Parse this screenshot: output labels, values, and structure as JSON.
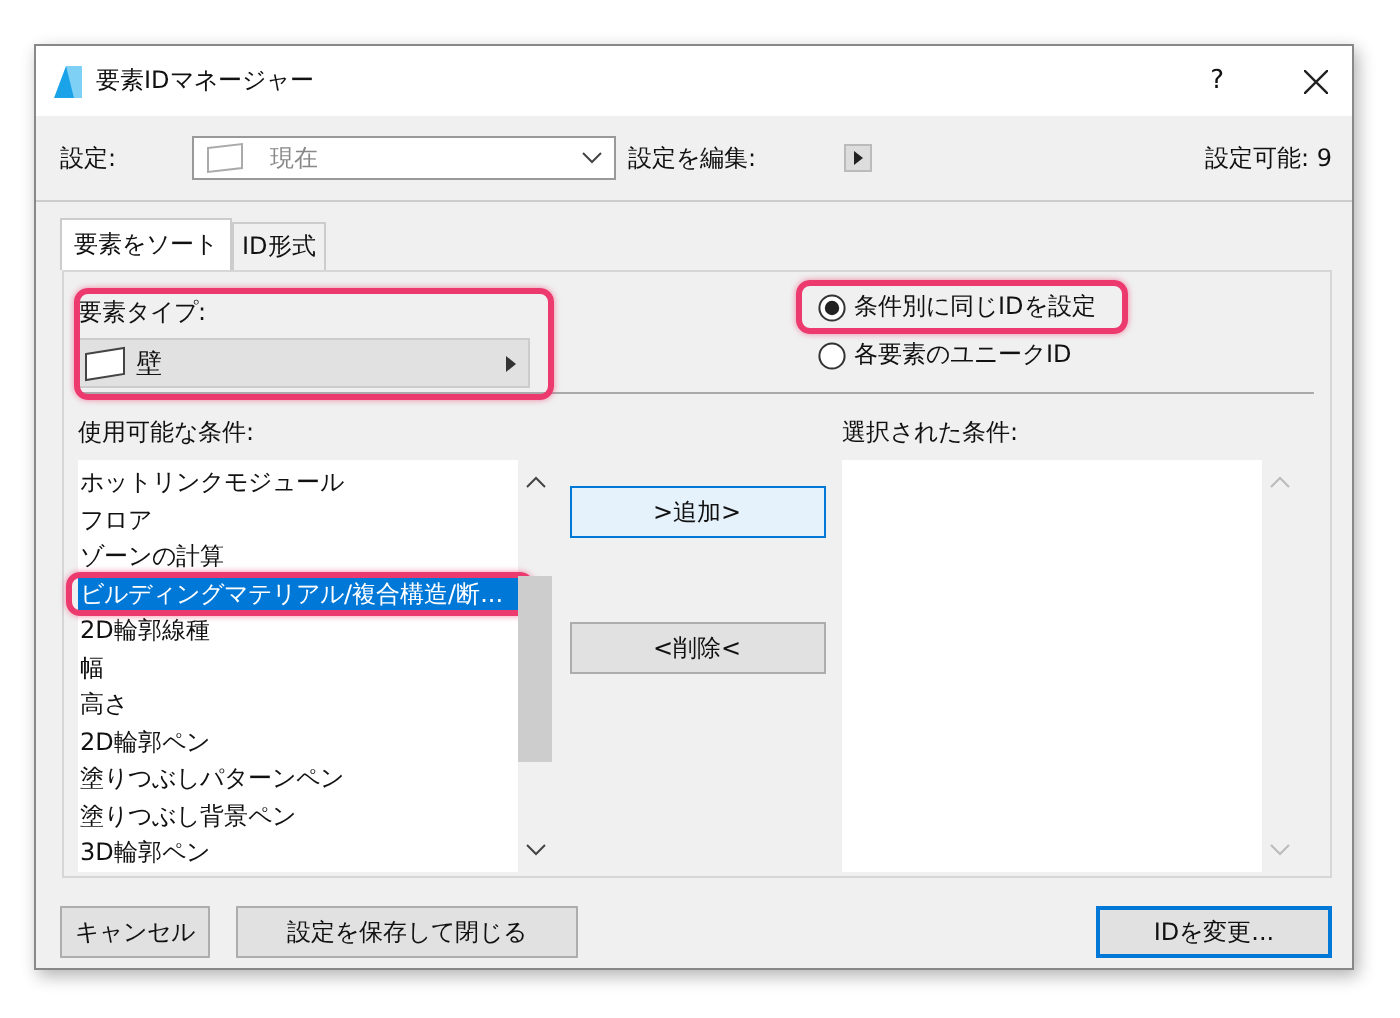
{
  "window": {
    "title": "要素IDマネージャー",
    "help": "?"
  },
  "settings": {
    "label": "設定:",
    "value": "現在",
    "edit_label": "設定を編集:",
    "available": "設定可能: 9"
  },
  "tabs": [
    {
      "label": "要素をソート",
      "selected": true
    },
    {
      "label": "ID形式",
      "selected": false
    }
  ],
  "element_type": {
    "label": "要素タイプ:",
    "value": "壁",
    "highlighted": true
  },
  "id_mode": [
    {
      "label": "条件別に同じIDを設定",
      "selected": true,
      "highlighted": true
    },
    {
      "label": "各要素のユニークID",
      "selected": false,
      "highlighted": false
    }
  ],
  "available": {
    "label": "使用可能な条件:",
    "items": [
      {
        "label": "ホットリンクモジュール",
        "selected": false,
        "highlighted": false
      },
      {
        "label": "フロア",
        "selected": false,
        "highlighted": false
      },
      {
        "label": "ゾーンの計算",
        "selected": false,
        "highlighted": false
      },
      {
        "label": "ビルディングマテリアル/複合構造/断...",
        "selected": true,
        "highlighted": true
      },
      {
        "label": "2D輪郭線種",
        "selected": false,
        "highlighted": false
      },
      {
        "label": "幅",
        "selected": false,
        "highlighted": false
      },
      {
        "label": "高さ",
        "selected": false,
        "highlighted": false
      },
      {
        "label": "2D輪郭ペン",
        "selected": false,
        "highlighted": false
      },
      {
        "label": "塗りつぶしパターンペン",
        "selected": false,
        "highlighted": false
      },
      {
        "label": "塗りつぶし背景ペン",
        "selected": false,
        "highlighted": false
      },
      {
        "label": "3D輪郭ペン",
        "selected": false,
        "highlighted": false
      }
    ]
  },
  "add_button": ">追加>",
  "remove_button": "<削除<",
  "selected_criteria": {
    "label": "選択された条件:"
  },
  "buttons": [
    {
      "label": "キャンセル",
      "default": false
    },
    {
      "label": "設定を保存して閉じる",
      "default": false
    },
    {
      "label": "IDを変更...",
      "default": true
    }
  ]
}
